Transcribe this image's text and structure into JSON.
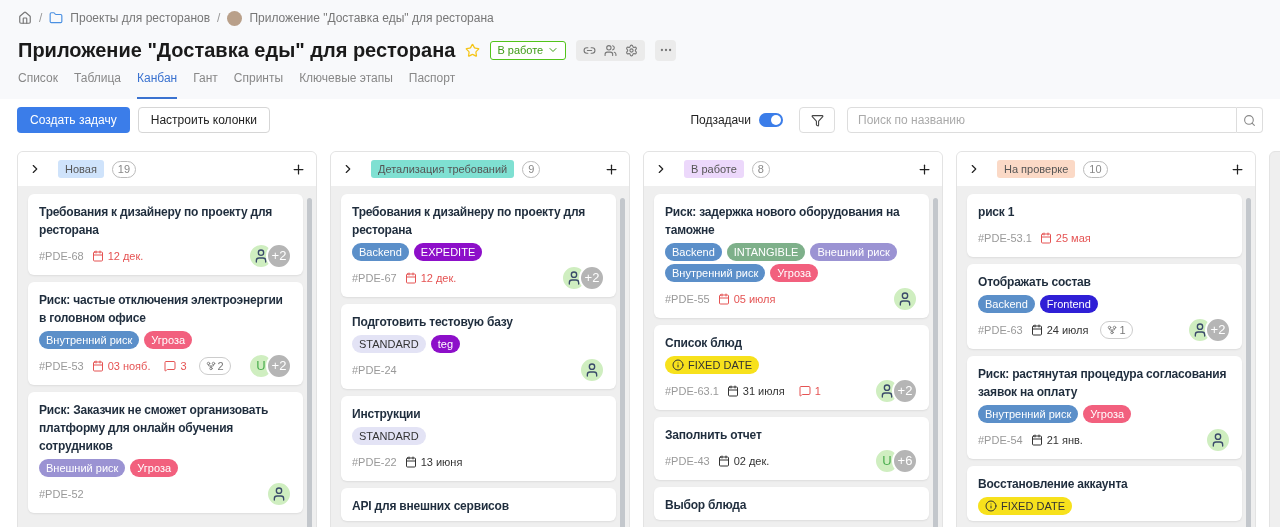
{
  "breadcrumbs": [
    {
      "kind": "home"
    },
    {
      "kind": "folder",
      "label": "Проекты для ресторанов"
    },
    {
      "kind": "project",
      "label": "Приложение \"Доставка еды\" для ресторана"
    }
  ],
  "breadcrumb_separator": "/",
  "title": "Приложение \"Доставка еды\" для ресторана",
  "favorite": false,
  "status": "В работе",
  "tabs": [
    {
      "label": "Список",
      "selected": false
    },
    {
      "label": "Таблица",
      "selected": false
    },
    {
      "label": "Канбан",
      "selected": true
    },
    {
      "label": "Гант",
      "selected": false
    },
    {
      "label": "Спринты",
      "selected": false
    },
    {
      "label": "Ключевые этапы",
      "selected": false
    },
    {
      "label": "Паспорт",
      "selected": false
    }
  ],
  "toolbar": {
    "create_button": "Создать задачу",
    "columns_button": "Настроить колонки",
    "subtasks_label": "Подзадачи",
    "subtasks_on": true,
    "search": {
      "placeholder": "Поиск по названию"
    }
  },
  "columns": [
    {
      "name": "Новая",
      "color": "#cfe3fb",
      "count": "19",
      "cards": [
        {
          "title": "Требования к дизайнеру по проекту для ресторана",
          "id": "#PDE-68",
          "date": {
            "text": "12 дек.",
            "overdue": true
          },
          "avatars": [
            {
              "kind": "person"
            },
            {
              "kind": "more",
              "text": "+2"
            }
          ]
        },
        {
          "title": "Риск: частые отключения электроэнергии в головном офисе",
          "tags": [
            {
              "label": "Внутренний риск",
              "color": "#5b8fc9"
            },
            {
              "label": "Угроза",
              "color": "#f2607e"
            }
          ],
          "id": "#PDE-53",
          "date": {
            "text": "03 нояб.",
            "overdue": true
          },
          "comments": "3",
          "subtasks": "2",
          "avatars": [
            {
              "kind": "letter",
              "text": "U"
            },
            {
              "kind": "more",
              "text": "+2"
            }
          ]
        },
        {
          "title": "Риск: Заказчик не сможет организовать платформу для онлайн обучения сотрудников",
          "tags": [
            {
              "label": "Внешний риск",
              "color": "#9b93d3"
            },
            {
              "label": "Угроза",
              "color": "#f2607e"
            }
          ],
          "id": "#PDE-52",
          "avatars": [
            {
              "kind": "person"
            }
          ]
        }
      ]
    },
    {
      "name": "Детализация требований",
      "color": "#7fe0d2",
      "count": "9",
      "cards": [
        {
          "title": "Требования к дизайнеру по проекту для ресторана",
          "tags": [
            {
              "label": "Backend",
              "color": "#5b8fc9"
            },
            {
              "label": "EXPEDITE",
              "color": "#8d0fc9"
            }
          ],
          "id": "#PDE-67",
          "date": {
            "text": "12 дек.",
            "overdue": true
          },
          "avatars": [
            {
              "kind": "person"
            },
            {
              "kind": "more",
              "text": "+2"
            }
          ]
        },
        {
          "title": "Подготовить тестовую базу",
          "tags": [
            {
              "label": "STANDARD",
              "color": "#e3e3f5"
            },
            {
              "label": "teg",
              "color": "#8d0fc9"
            }
          ],
          "id": "#PDE-24",
          "avatars": [
            {
              "kind": "person"
            }
          ]
        },
        {
          "title": "Инструкции",
          "tags": [
            {
              "label": "STANDARD",
              "color": "#e3e3f5"
            }
          ],
          "id": "#PDE-22",
          "date": {
            "text": "13 июня",
            "overdue": false
          }
        },
        {
          "title": "API для внешних сервисов"
        }
      ]
    },
    {
      "name": "В работе",
      "color": "#ecd8fb",
      "count": "8",
      "cards": [
        {
          "title": "Риск: задержка нового оборудования на таможне",
          "tags": [
            {
              "label": "Backend",
              "color": "#5b8fc9"
            },
            {
              "label": "INTANGIBLE",
              "color": "#7eb08a"
            },
            {
              "label": "Внешний риск",
              "color": "#9b93d3"
            },
            {
              "label": "Внутренний риск",
              "color": "#5b8fc9"
            },
            {
              "label": "Угроза",
              "color": "#f2607e"
            }
          ],
          "id": "#PDE-55",
          "date": {
            "text": "05 июля",
            "overdue": true
          },
          "avatars": [
            {
              "kind": "person"
            }
          ]
        },
        {
          "title": "Список блюд",
          "tags": [
            {
              "label": "FIXED DATE",
              "color": "#f7e11c",
              "kind": "fixed"
            }
          ],
          "id": "#PDE-63.1",
          "date": {
            "text": "31 июля",
            "overdue": false
          },
          "comments": "1",
          "avatars": [
            {
              "kind": "person"
            },
            {
              "kind": "more",
              "text": "+2"
            }
          ]
        },
        {
          "title": "Заполнить отчет",
          "id": "#PDE-43",
          "date": {
            "text": "02 дек.",
            "overdue": false
          },
          "avatars": [
            {
              "kind": "letter",
              "text": "U"
            },
            {
              "kind": "more",
              "text": "+6"
            }
          ]
        },
        {
          "title": "Выбор блюда"
        }
      ]
    },
    {
      "name": "На проверке",
      "color": "#fbd9c6",
      "count": "10",
      "cards": [
        {
          "title": "риск 1",
          "id": "#PDE-53.1",
          "date": {
            "text": "25 мая",
            "overdue": true
          }
        },
        {
          "title": "Отображать состав",
          "tags": [
            {
              "label": "Backend",
              "color": "#5b8fc9"
            },
            {
              "label": "Frontend",
              "color": "#2f1fd6"
            }
          ],
          "id": "#PDE-63",
          "date": {
            "text": "24 июля",
            "overdue": false
          },
          "subtasks": "1",
          "avatars": [
            {
              "kind": "person"
            },
            {
              "kind": "more",
              "text": "+2"
            }
          ]
        },
        {
          "title": "Риск: растянутая процедура согласования заявок на оплату",
          "tags": [
            {
              "label": "Внутренний риск",
              "color": "#5b8fc9"
            },
            {
              "label": "Угроза",
              "color": "#f2607e"
            }
          ],
          "id": "#PDE-54",
          "date": {
            "text": "21 янв.",
            "overdue": false
          },
          "avatars": [
            {
              "kind": "person"
            }
          ]
        },
        {
          "title": "Восстановление аккаунта",
          "tags": [
            {
              "label": "FIXED DATE",
              "color": "#f7e11c",
              "kind": "fixed"
            }
          ]
        }
      ]
    }
  ]
}
